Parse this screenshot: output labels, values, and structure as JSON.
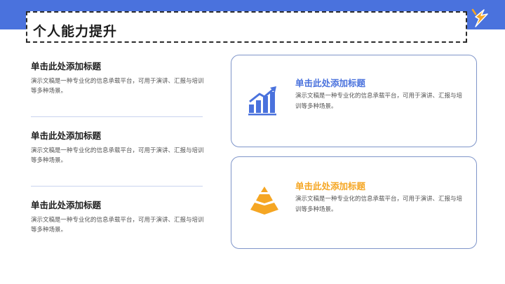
{
  "header": {
    "title": "个人能力提升"
  },
  "left_items": [
    {
      "title": "单击此处添加标题",
      "desc": "演示文稿是一种专业化的信息承载平台，可用于演讲、汇报与培训等多种场景。"
    },
    {
      "title": "单击此处添加标题",
      "desc": "演示文稿是一种专业化的信息承载平台，可用于演讲、汇报与培训等多种场景。"
    },
    {
      "title": "单击此处添加标题",
      "desc": "演示文稿是一种专业化的信息承载平台，可用于演讲、汇报与培训等多种场景。"
    }
  ],
  "cards": [
    {
      "title": "单击此处添加标题",
      "desc": "演示文稿是一种专业化的信息承载平台，可用于演讲、汇报与培训等多种场景。",
      "icon": "bar-chart-growth-icon",
      "color": "#4a72dd"
    },
    {
      "title": "单击此处添加标题",
      "desc": "演示文稿是一种专业化的信息承载平台，可用于演讲、汇报与培训等多种场景。",
      "icon": "pyramid-icon",
      "color": "#f5a623"
    }
  ],
  "colors": {
    "primary": "#4a72dd",
    "accent": "#f5a623"
  }
}
